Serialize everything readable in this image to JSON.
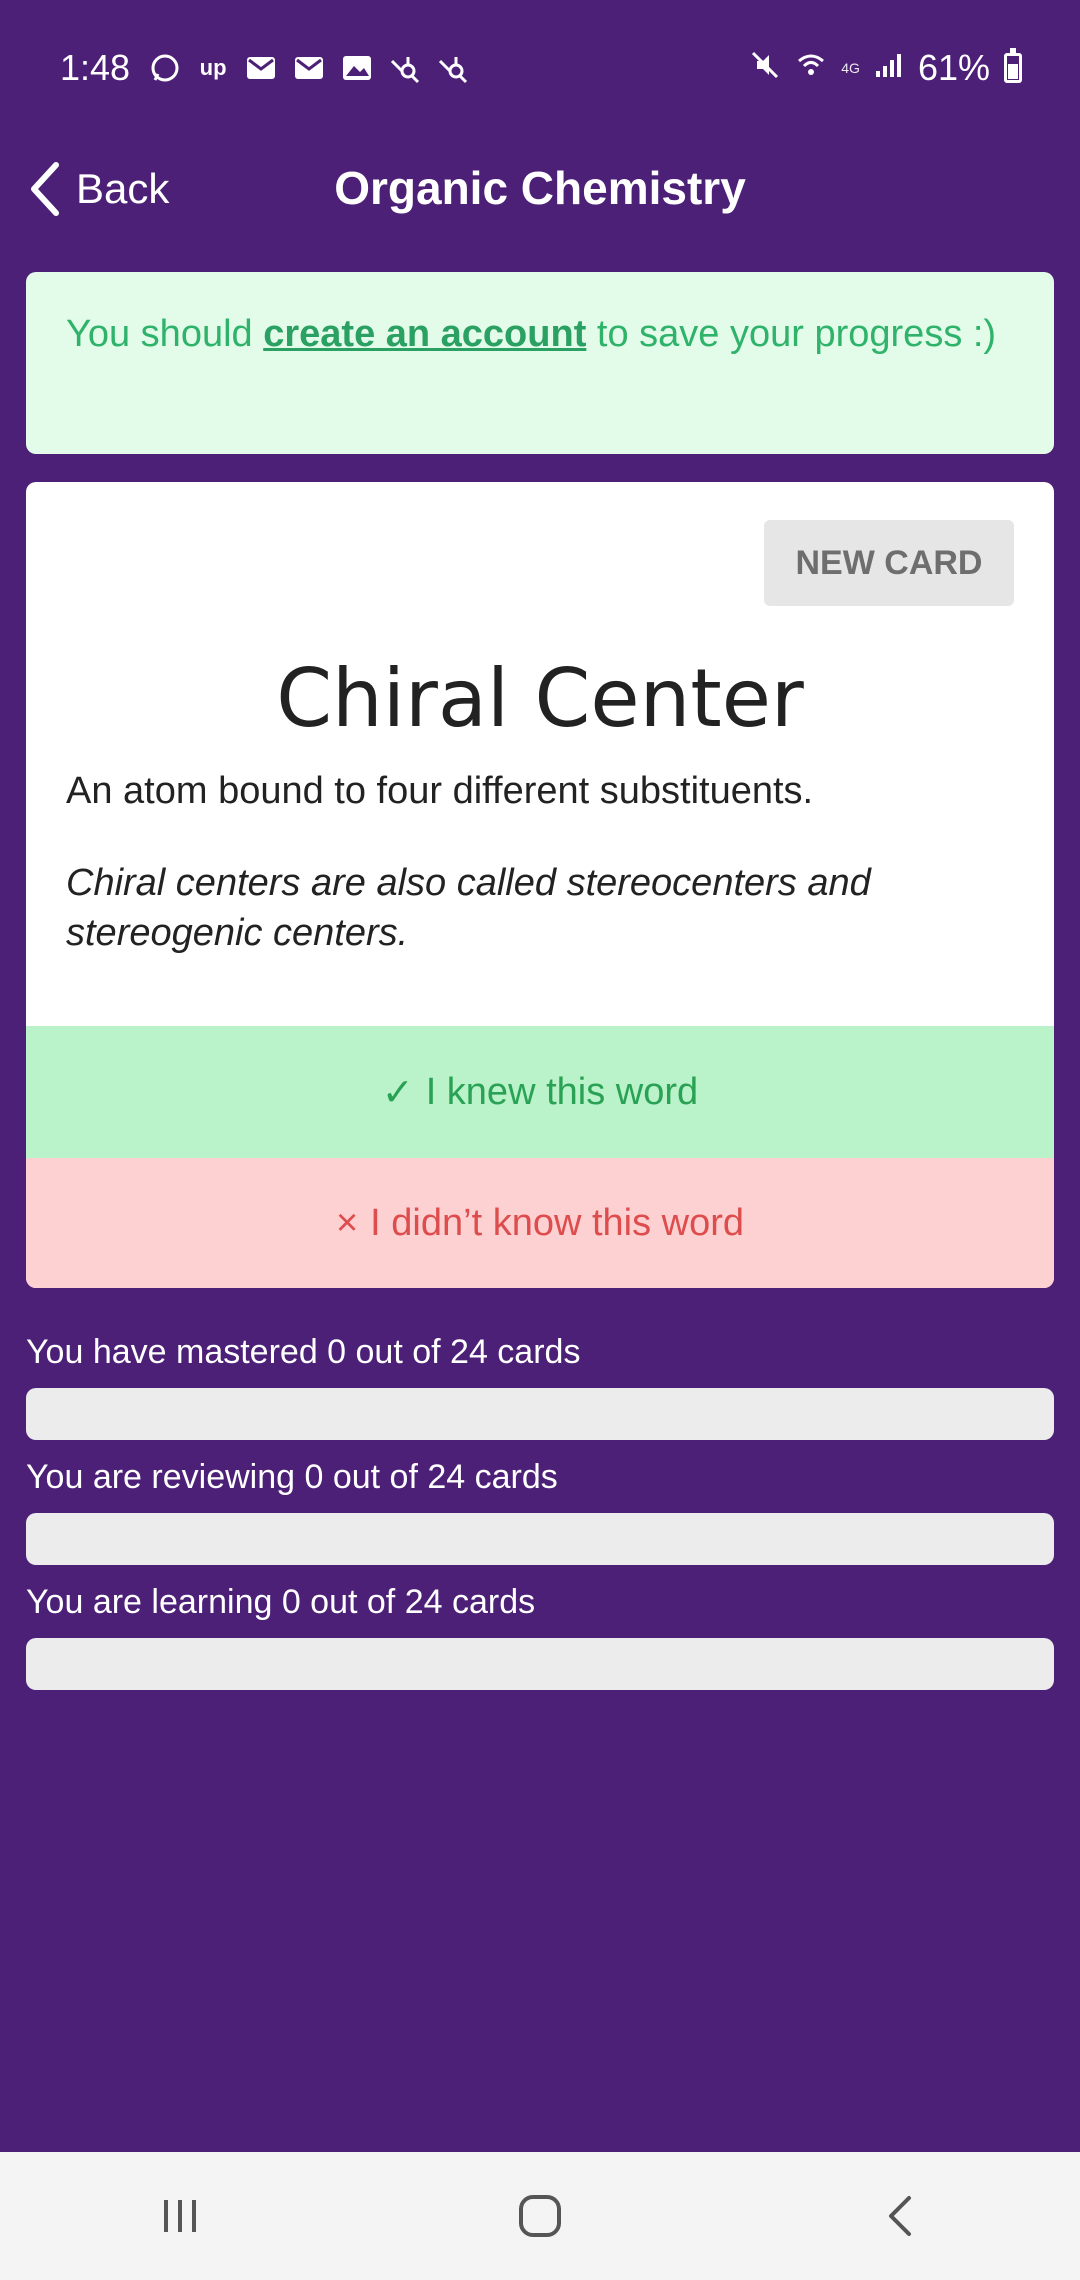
{
  "status_bar": {
    "time": "1:48",
    "network": "4G",
    "battery": "61%",
    "battery_level": 0.61,
    "notification_icons": [
      "whatsapp-icon",
      "upwork-icon",
      "gmail-icon",
      "gmail-icon",
      "gallery-icon",
      "hubspot-icon",
      "hubspot-icon"
    ],
    "system_icons": [
      "mute-icon",
      "wifi-icon",
      "signal-icon",
      "battery-icon"
    ]
  },
  "header": {
    "back_label": "Back",
    "title": "Organic Chemistry"
  },
  "banner": {
    "prefix": "You should ",
    "link": "create an account",
    "suffix": " to save your progress :)"
  },
  "card": {
    "new_card_label": "NEW CARD",
    "term": "Chiral Center",
    "definition": "An atom bound to four different substituents.",
    "note": "Chiral centers are also called stereocenters and stereogenic centers.",
    "knew_icon": "✓",
    "knew_label": "I knew this word",
    "didnt_icon": "×",
    "didnt_label": "I didn’t know this word"
  },
  "progress": {
    "mastered_label": "You have mastered 0 out of 24 cards",
    "mastered_value": 0,
    "reviewing_label": "You are reviewing 0 out of 24 cards",
    "reviewing_value": 0,
    "learning_label": "You are learning 0 out of 24 cards",
    "learning_value": 0,
    "total": 24
  },
  "colors": {
    "background": "#4d2077",
    "banner_bg": "#e3fbe9",
    "knew_bg": "#baf2c9",
    "didnt_bg": "#fdd0d1",
    "accent_green": "#2fb36b",
    "accent_red": "#de4d4d"
  },
  "navbar": {
    "icons": [
      "recent-apps-icon",
      "home-icon",
      "back-nav-icon"
    ]
  }
}
